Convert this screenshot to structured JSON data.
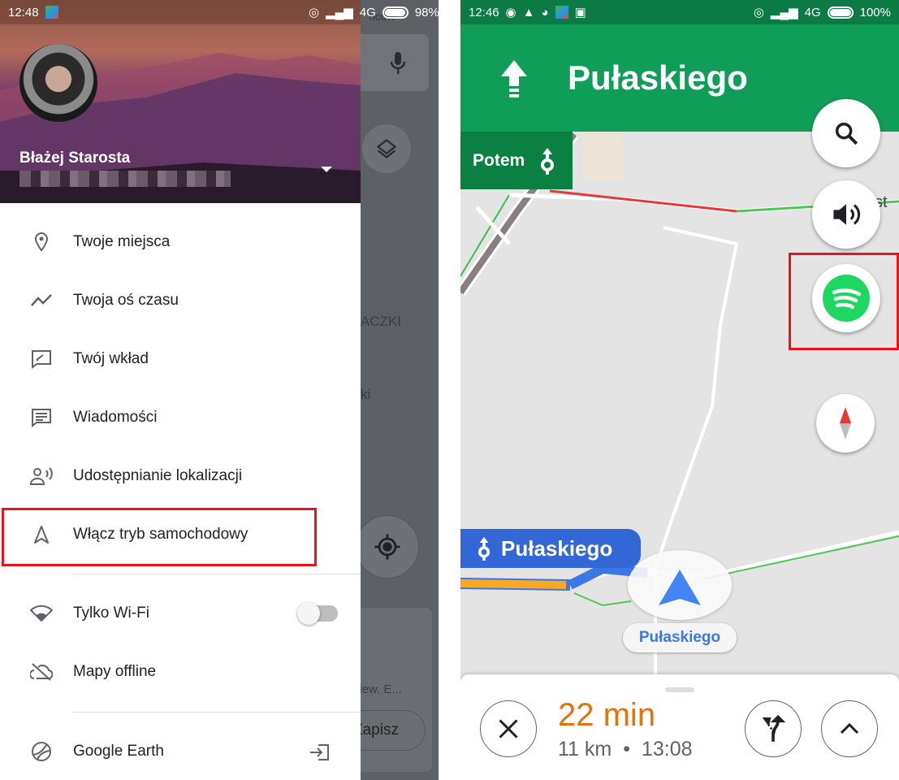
{
  "left_screen": {
    "status_bar": {
      "time": "12:48",
      "network": "4G",
      "battery": "98%"
    },
    "account": {
      "name": "Błażej Starosta"
    },
    "menu": [
      {
        "label": "Twoje miejsca",
        "icon": "pin-icon"
      },
      {
        "label": "Twoja oś czasu",
        "icon": "timeline-icon"
      },
      {
        "label": "Twój wkład",
        "icon": "contribute-icon"
      },
      {
        "label": "Wiadomości",
        "icon": "message-icon"
      },
      {
        "label": "Udostępnianie lokalizacji",
        "icon": "location-sharing-icon"
      },
      {
        "label": "Włącz tryb samochodowy",
        "icon": "navigation-arrow-icon",
        "highlighted": true
      },
      {
        "label": "Tylko Wi-Fi",
        "icon": "wifi-icon",
        "toggle": false
      },
      {
        "label": "Mapy offline",
        "icon": "cloud-off-icon"
      },
      {
        "label": "Google Earth",
        "icon": "earth-icon"
      }
    ],
    "map_behind": {
      "place1": "ACZKI",
      "place2": "ki",
      "card_text": "niew. E...",
      "save_label": "Zapisz",
      "top_text": "ncow"
    }
  },
  "right_screen": {
    "status_bar": {
      "time": "12:46",
      "network": "4G",
      "battery": "100%"
    },
    "banner": {
      "street": "Pułaskiego",
      "then_label": "Potem"
    },
    "next_street_label": "Pułaskiego",
    "current_street": "Pułaskiego",
    "map_text": "yst",
    "eta": {
      "duration": "22 min",
      "distance": "11 km",
      "separator": "•",
      "arrival": "13:08"
    },
    "colors": {
      "banner": "#0f9d58",
      "eta": "#e8710a",
      "route": "#3b78e7",
      "spotify": "#1ed760",
      "highlight": "#e8141c"
    }
  }
}
